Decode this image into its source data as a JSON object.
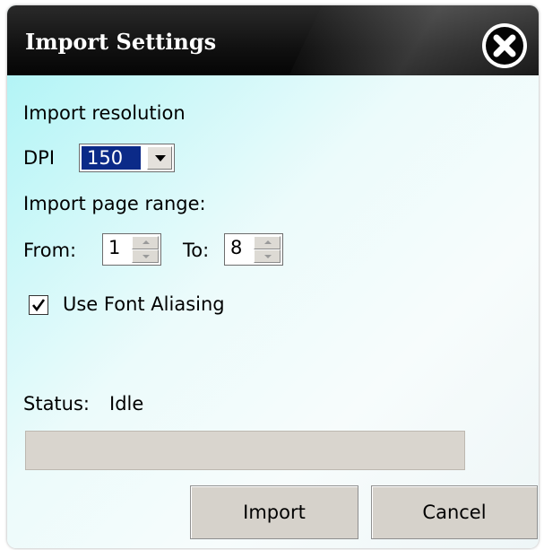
{
  "dialog": {
    "title": "Import Settings",
    "close_icon": "close-x-icon"
  },
  "resolution": {
    "heading": "Import resolution",
    "dpi_label": "DPI",
    "dpi_value": "150"
  },
  "page_range": {
    "heading": "Import page range:",
    "from_label": "From:",
    "from_value": "1",
    "to_label": "To:",
    "to_value": "8"
  },
  "options": {
    "font_aliasing_label": "Use Font Aliasing",
    "font_aliasing_checked": true
  },
  "status": {
    "label": "Status:",
    "value": "Idle",
    "progress": 0
  },
  "buttons": {
    "import": "Import",
    "cancel": "Cancel"
  },
  "colors": {
    "titlebar": "#111111",
    "selection": "#0b2a88",
    "panel_top": "#a9f3f5",
    "button_face": "#d6d2cb"
  }
}
